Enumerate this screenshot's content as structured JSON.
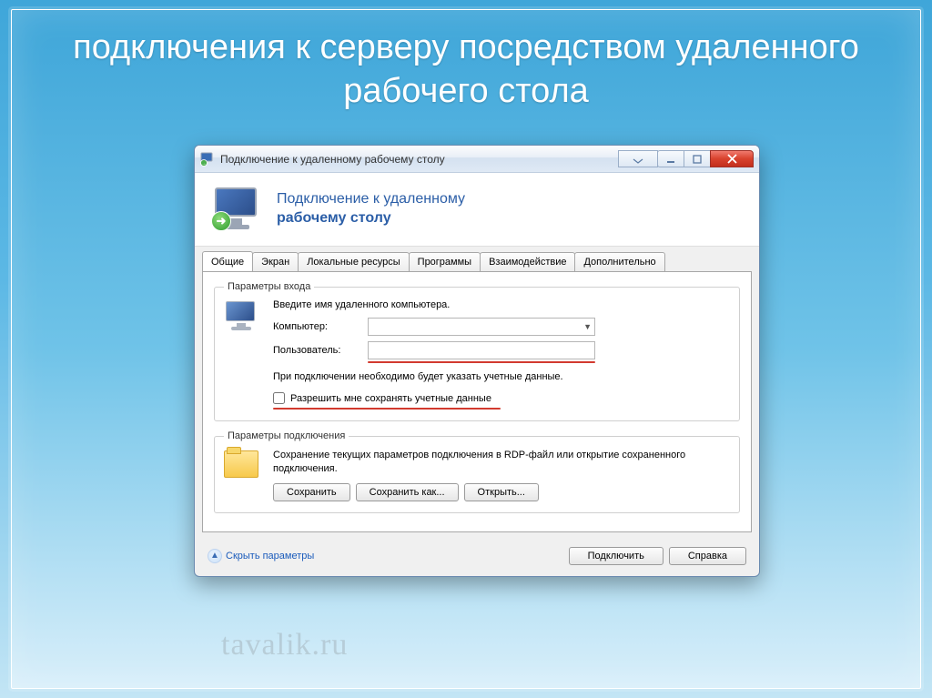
{
  "slide_title": "подключения к серверу посредством удаленного рабочего стола",
  "window": {
    "title": "Подключение к удаленному рабочему столу",
    "header_line1": "Подключение к удаленному",
    "header_line2": "рабочему столу"
  },
  "tabs": [
    "Общие",
    "Экран",
    "Локальные ресурсы",
    "Программы",
    "Взаимодействие",
    "Дополнительно"
  ],
  "login_group": {
    "legend": "Параметры входа",
    "instruction": "Введите имя удаленного компьютера.",
    "computer_label": "Компьютер:",
    "computer_value": "",
    "user_label": "Пользователь:",
    "user_value": "",
    "note": "При подключении необходимо будет указать учетные данные.",
    "checkbox_label": "Разрешить мне сохранять учетные данные"
  },
  "conn_group": {
    "legend": "Параметры подключения",
    "text": "Сохранение текущих параметров подключения в RDP-файл или открытие сохраненного подключения.",
    "save": "Сохранить",
    "save_as": "Сохранить как...",
    "open": "Открыть..."
  },
  "footer": {
    "hide": "Скрыть параметры",
    "connect": "Подключить",
    "help": "Справка"
  },
  "watermark": "tavalik.ru"
}
